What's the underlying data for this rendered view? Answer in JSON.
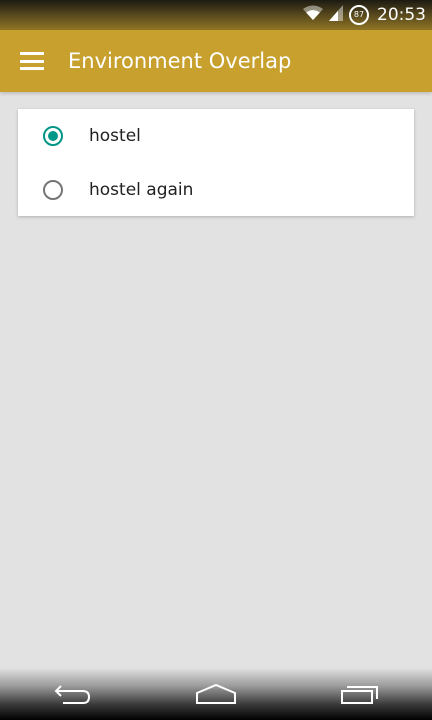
{
  "status_bar": {
    "battery": "87",
    "time": "20:53",
    "icons": [
      "wifi-icon",
      "signal-icon",
      "battery-icon"
    ]
  },
  "app_bar": {
    "title": "Environment Overlap",
    "background_color": "#c7a02d",
    "menu_icon": "menu-icon"
  },
  "options": [
    {
      "label": "hostel",
      "selected": true
    },
    {
      "label": "hostel again",
      "selected": false
    }
  ],
  "accent_color": "#009688",
  "nav_bar": {
    "icons": [
      "back-icon",
      "home-icon",
      "recents-icon"
    ]
  }
}
